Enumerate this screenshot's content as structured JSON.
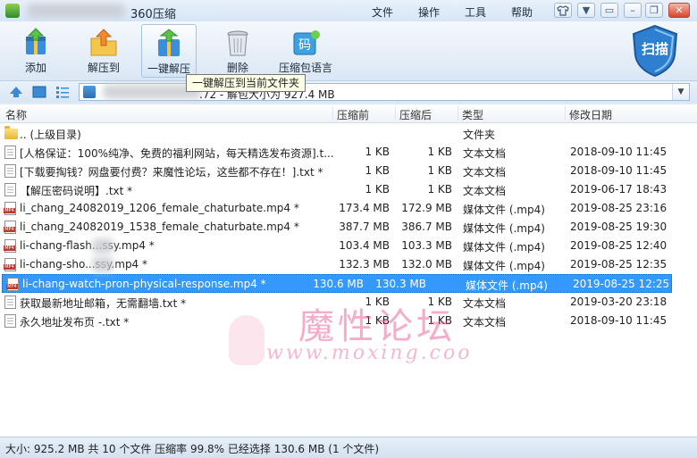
{
  "window": {
    "title": "360压缩",
    "menus": [
      "文件",
      "操作",
      "工具",
      "帮助"
    ],
    "controls": [
      "shirt-icon",
      "minimize",
      "restore",
      "close"
    ]
  },
  "toolbar": {
    "buttons": [
      {
        "label": "添加",
        "icon": "add-archive-icon"
      },
      {
        "label": "解压到",
        "icon": "extract-to-icon"
      },
      {
        "label": "一键解压",
        "icon": "one-click-extract-icon"
      },
      {
        "label": "删除",
        "icon": "delete-bin-icon"
      },
      {
        "label": "压缩包语言",
        "icon": "archive-language-icon"
      }
    ],
    "scan_label": "扫描"
  },
  "tooltip": "一键解压到当前文件夹",
  "address": {
    "text": ".72 - 解包大小为 927.4 MB"
  },
  "columns": [
    "名称",
    "压缩前",
    "压缩后",
    "类型",
    "修改日期"
  ],
  "files": [
    {
      "icon": "folder",
      "name": ".. (上级目录)",
      "before": "",
      "after": "",
      "type": "文件夹",
      "date": ""
    },
    {
      "icon": "txt",
      "name": "[人格保证：100%纯净、免费的福利网站，每天精选发布资源].t...",
      "before": "1 KB",
      "after": "1 KB",
      "type": "文本文档",
      "date": "2018-09-10 11:45"
    },
    {
      "icon": "txt",
      "name": "[下载要掏钱？网盘要付费？来魔性论坛，这些都不存在！].txt *",
      "before": "1 KB",
      "after": "1 KB",
      "type": "文本文档",
      "date": "2018-09-10 11:45"
    },
    {
      "icon": "txt",
      "name": "【解压密码说明】.txt *",
      "before": "1 KB",
      "after": "1 KB",
      "type": "文本文档",
      "date": "2019-06-17 18:43"
    },
    {
      "icon": "mp4",
      "name": "li_chang_24082019_1206_female_chaturbate.mp4 *",
      "before": "173.4 MB",
      "after": "172.9 MB",
      "type": "媒体文件 (.mp4)",
      "date": "2019-08-25 23:16"
    },
    {
      "icon": "mp4",
      "name": "li_chang_24082019_1538_female_chaturbate.mp4 *",
      "before": "387.7 MB",
      "after": "386.7 MB",
      "type": "媒体文件 (.mp4)",
      "date": "2019-08-25 19:30"
    },
    {
      "icon": "mp4",
      "name": "li-chang-flash...ssy.mp4 *",
      "before": "103.4 MB",
      "after": "103.3 MB",
      "type": "媒体文件 (.mp4)",
      "date": "2019-08-25 12:40"
    },
    {
      "icon": "mp4",
      "name": "li-chang-sho...ssy.mp4 *",
      "before": "132.3 MB",
      "after": "132.0 MB",
      "type": "媒体文件 (.mp4)",
      "date": "2019-08-25 12:35"
    },
    {
      "icon": "mp4",
      "name": "li-chang-watch-pron-physical-response.mp4 *",
      "before": "130.6 MB",
      "after": "130.3 MB",
      "type": "媒体文件 (.mp4)",
      "date": "2019-08-25 12:25",
      "selected": true
    },
    {
      "icon": "txt",
      "name": "获取最新地址邮箱，无需翻墙.txt *",
      "before": "1 KB",
      "after": "1 KB",
      "type": "文本文档",
      "date": "2019-03-20 23:18"
    },
    {
      "icon": "txt",
      "name": "永久地址发布页 -.txt *",
      "before": "1 KB",
      "after": "1 KB",
      "type": "文本文档",
      "date": "2018-09-10 11:45"
    }
  ],
  "watermark": {
    "big": "魔性论坛",
    "small": "www.moxing.coo"
  },
  "status": "大小: 925.2 MB 共 10 个文件 压缩率 99.8% 已经选择 130.6 MB (1 个文件)"
}
